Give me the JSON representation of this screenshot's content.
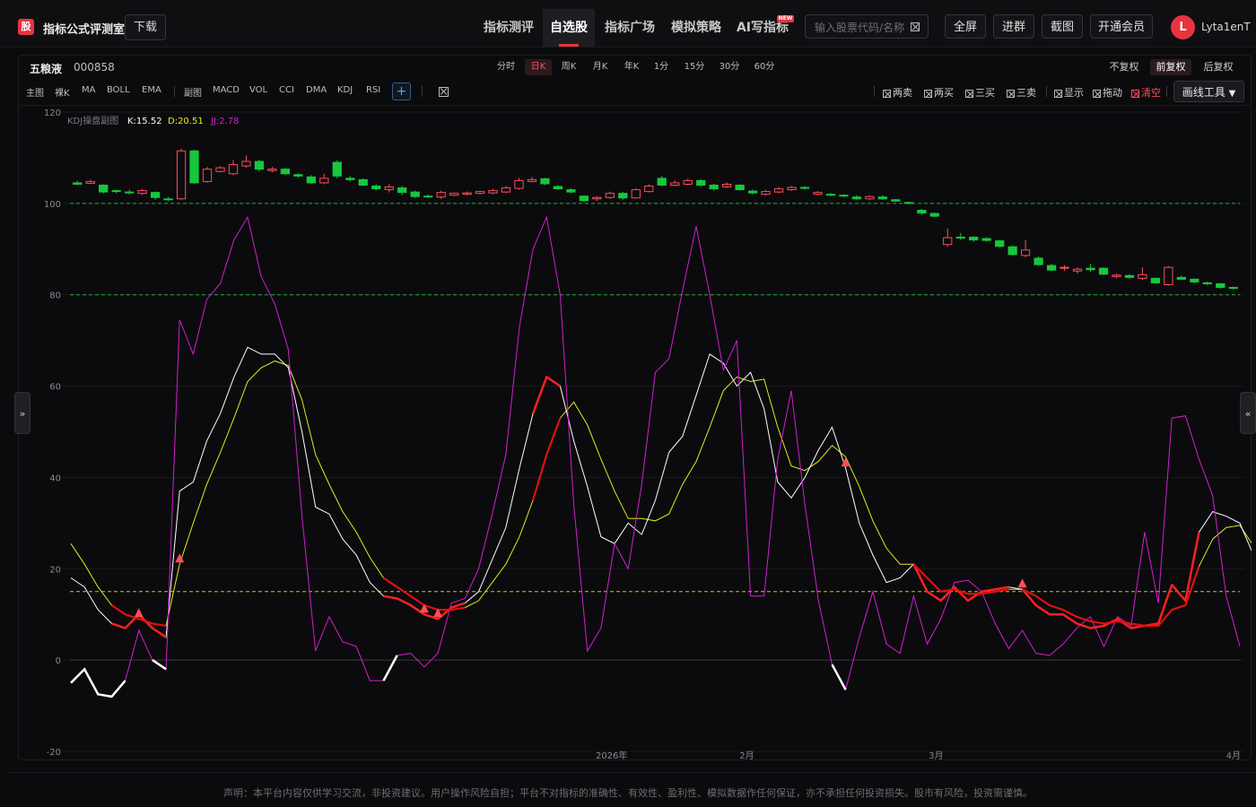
{
  "header": {
    "logo_text": "股",
    "app_title": "指标公式评测室",
    "download_label": "下载",
    "nav": [
      {
        "label": "指标测评",
        "active": false
      },
      {
        "label": "自选股",
        "active": true
      },
      {
        "label": "指标广场",
        "active": false
      },
      {
        "label": "模拟策略",
        "active": false
      },
      {
        "label": "AI写指标",
        "active": false
      }
    ],
    "new_badge": "NEW",
    "search_placeholder": "输入股票代码/名称",
    "buttons": {
      "fullscreen": "全屏",
      "join_group": "进群",
      "screenshot": "截图",
      "membership": "开通会员"
    },
    "avatar_letter": "L",
    "username": "Lyta1enT"
  },
  "stock": {
    "name": "五粮液",
    "code": "000858"
  },
  "periods": [
    {
      "label": "分时",
      "active": false
    },
    {
      "label": "日K",
      "active": true
    },
    {
      "label": "周K",
      "active": false
    },
    {
      "label": "月K",
      "active": false
    },
    {
      "label": "年K",
      "active": false
    },
    {
      "label": "1分",
      "active": false
    },
    {
      "label": "15分",
      "active": false
    },
    {
      "label": "30分",
      "active": false
    },
    {
      "label": "60分",
      "active": false
    }
  ],
  "adjust": [
    {
      "label": "不复权",
      "active": false
    },
    {
      "label": "前复权",
      "active": true
    },
    {
      "label": "后复权",
      "active": false
    }
  ],
  "main_indicators": [
    "主图",
    "裸K",
    "MA",
    "BOLL",
    "EMA"
  ],
  "sub_indicators": [
    "副图",
    "MACD",
    "VOL",
    "CCI",
    "DMA",
    "KDJ",
    "RSI"
  ],
  "signal_tools": [
    {
      "label": "两卖",
      "red": false
    },
    {
      "label": "两买",
      "red": false
    },
    {
      "label": "三买",
      "red": false
    },
    {
      "label": "三卖",
      "red": false
    },
    {
      "label": "显示",
      "red": false
    },
    {
      "label": "拖动",
      "red": false
    },
    {
      "label": "清空",
      "red": true
    }
  ],
  "draw_tools_label": "画线工具",
  "sidebar_toggle_left": "»",
  "sidebar_toggle_right": "«",
  "disclaimer": "声明：本平台内容仅供学习交流，非投资建议。用户操作风险自担；平台不对指标的准确性、有效性、盈利性、模拟数据作任何保证，亦不承担任何投资损失。股市有风险，投资需谨慎。",
  "chart_data": {
    "type": "line",
    "indicator_label": "KDJ操盘副图",
    "legend": [
      {
        "label": "K:15.52",
        "color": "#ffffff"
      },
      {
        "label": "D:20.51",
        "color": "#e8e820"
      },
      {
        "label": "JJ:2.78",
        "color": "#d020d0"
      }
    ],
    "ylim": [
      -20,
      120
    ],
    "y_ticks": [
      -20,
      0,
      20,
      40,
      60,
      80,
      100,
      120
    ],
    "x_labels": [
      {
        "index": 20,
        "label": "2026年"
      },
      {
        "index": 25,
        "label": "2月"
      },
      {
        "index": 32,
        "label": "3月"
      },
      {
        "index": 43,
        "label": "4月"
      }
    ],
    "levels": [
      {
        "value": 100,
        "color": "#1fae3a"
      },
      {
        "value": 80,
        "color": "#1fae3a"
      },
      {
        "value": 15,
        "color": "#c8c820"
      },
      {
        "value": 0,
        "color": "#3a3a3e"
      }
    ],
    "k": [
      18,
      16,
      11,
      8,
      7,
      10,
      7,
      5,
      37,
      39,
      48,
      54,
      62,
      68.5,
      67,
      67,
      64,
      50,
      33.5,
      32,
      26.5,
      23,
      17,
      14,
      13.5,
      12,
      10,
      9,
      11.5,
      12.5,
      15,
      22,
      29,
      42,
      54,
      62,
      60,
      48,
      38,
      27,
      25.5,
      30,
      27.5,
      35,
      45.5,
      49,
      58,
      67,
      65,
      60,
      63,
      55,
      39,
      35.5,
      40,
      46,
      51,
      42,
      30,
      23,
      17,
      18,
      21,
      15,
      13,
      16,
      13,
      15,
      15.5,
      16,
      15.5,
      12,
      10,
      10,
      8,
      7,
      7.5,
      9,
      7,
      7.5,
      8,
      16.5,
      13,
      28,
      32.5,
      31.5,
      30,
      23,
      15.5
    ],
    "d": [
      25.5,
      21,
      16,
      12,
      10,
      9,
      8,
      7.5,
      21,
      30,
      38.5,
      45.5,
      53,
      61,
      64,
      65.5,
      64.5,
      57,
      45,
      38.5,
      32.5,
      28,
      22.5,
      18,
      16,
      14,
      12,
      11,
      11,
      11.5,
      13,
      17,
      21,
      27,
      35,
      45,
      53,
      56.5,
      51.5,
      44,
      37,
      31,
      31,
      30.5,
      32,
      38.5,
      43.5,
      51,
      59,
      62,
      61,
      61.5,
      51,
      42.5,
      41.5,
      43.5,
      47,
      44.5,
      38,
      30.5,
      24.5,
      21,
      21,
      18,
      15,
      15.5,
      14.5,
      14.5,
      15,
      15.5,
      15.5,
      14,
      12,
      11,
      9.5,
      8.5,
      8,
      8.5,
      8,
      7.5,
      7.5,
      11,
      12,
      20.5,
      26.5,
      29,
      29.5,
      25,
      20.5
    ],
    "j": [
      -5,
      -2,
      -7.5,
      -8,
      -4.5,
      6.5,
      0,
      -2,
      74.5,
      67,
      79,
      82.5,
      92,
      97,
      84,
      78,
      68,
      31.5,
      2,
      9.5,
      4,
      3,
      -4.5,
      -4.5,
      1,
      1.5,
      -1.5,
      1.5,
      12.5,
      13.5,
      20,
      32,
      45,
      73,
      90,
      97,
      80,
      34,
      2,
      7,
      25.5,
      20,
      38.5,
      63,
      66,
      81,
      95,
      80,
      63.5,
      70,
      14,
      14,
      44,
      59,
      34,
      13,
      -1,
      -6.5,
      5,
      15,
      3.5,
      1.5,
      14,
      3.5,
      9,
      17,
      17.5,
      15,
      8,
      2.5,
      6.5,
      1.5,
      1,
      3.5,
      7,
      9.5,
      3,
      9.5,
      7.5,
      28,
      12.5,
      53,
      53.5,
      44,
      36,
      14,
      3
    ],
    "k_white_segments": [
      [
        0,
        4
      ],
      [
        6,
        7
      ],
      [
        23,
        24
      ],
      [
        56,
        57
      ]
    ],
    "red_thick_segments": [
      [
        3,
        7
      ],
      [
        23,
        29
      ],
      [
        34,
        36
      ],
      [
        62,
        69
      ],
      [
        70,
        81
      ],
      [
        81,
        83
      ]
    ],
    "buy_markers": [
      5,
      8,
      26,
      27,
      57,
      70
    ],
    "candles": [
      [
        104.5,
        104.2,
        105,
        104
      ],
      [
        104.4,
        104.8,
        105.2,
        104.2
      ],
      [
        104,
        102.5,
        104.2,
        102.2
      ],
      [
        102.8,
        102.6,
        103,
        102.2
      ],
      [
        102.5,
        102.3,
        103,
        102
      ],
      [
        102.2,
        102.8,
        103.2,
        101.8
      ],
      [
        102.4,
        101.3,
        102.6,
        100.8
      ],
      [
        101,
        100.8,
        101.4,
        100.5
      ],
      [
        101,
        111.5,
        112,
        100.8
      ],
      [
        111.5,
        104.5,
        111.8,
        104.3
      ],
      [
        104.8,
        107.5,
        108,
        104.5
      ],
      [
        107,
        107.8,
        108.2,
        106.8
      ],
      [
        106.5,
        108.5,
        109.5,
        106.2
      ],
      [
        108.2,
        109.2,
        110.5,
        107.8
      ],
      [
        109.2,
        107.5,
        109.6,
        107
      ],
      [
        107.2,
        107.5,
        108,
        106.8
      ],
      [
        107.5,
        106.5,
        107.8,
        106.2
      ],
      [
        106.3,
        106,
        106.6,
        105.6
      ],
      [
        105.8,
        104.5,
        106.2,
        104.2
      ],
      [
        104.5,
        105.5,
        106.5,
        104.2
      ],
      [
        109,
        106,
        109.5,
        105.5
      ],
      [
        105.5,
        105.2,
        106,
        104.8
      ],
      [
        105.2,
        104,
        105.5,
        103.8
      ],
      [
        103.8,
        103.2,
        104.2,
        102.8
      ],
      [
        103,
        103.6,
        104.2,
        102.4
      ],
      [
        103.4,
        102.4,
        103.8,
        101.8
      ],
      [
        102.5,
        101.5,
        102.8,
        101.2
      ],
      [
        101.6,
        101.5,
        102,
        101.2
      ],
      [
        101.4,
        102.4,
        102.8,
        101
      ],
      [
        101.8,
        102.2,
        102.4,
        101.6
      ],
      [
        102,
        102.3,
        102.6,
        101.7
      ],
      [
        102.2,
        102.6,
        102.8,
        101.9
      ],
      [
        102.3,
        102.8,
        103.2,
        102
      ],
      [
        102.5,
        103.4,
        103.8,
        102.2
      ],
      [
        103.3,
        105,
        105.6,
        103
      ],
      [
        104.8,
        105.2,
        105.8,
        104.6
      ],
      [
        105.4,
        104.3,
        105.6,
        104
      ],
      [
        103.7,
        103.2,
        104,
        103
      ],
      [
        103,
        102.5,
        103.3,
        102.2
      ],
      [
        101.6,
        100.6,
        101.8,
        100.3
      ],
      [
        101,
        101.3,
        101.6,
        100.5
      ],
      [
        101.3,
        102.2,
        102.6,
        101
      ],
      [
        102.2,
        101.2,
        102.5,
        100.8
      ],
      [
        101.2,
        103,
        103.3,
        101
      ],
      [
        102.6,
        103.8,
        104.2,
        102.4
      ],
      [
        105.5,
        104,
        106,
        103.8
      ],
      [
        104,
        104.5,
        105,
        103.8
      ],
      [
        104.2,
        105,
        105.4,
        104
      ],
      [
        105,
        104,
        105.3,
        103.6
      ],
      [
        104,
        103.2,
        104.3,
        102.8
      ],
      [
        103.6,
        104.2,
        104.6,
        103.4
      ],
      [
        104,
        103,
        104.2,
        102.8
      ],
      [
        102.7,
        102.3,
        103,
        102
      ],
      [
        102,
        102.6,
        103,
        101.7
      ],
      [
        102.5,
        103.2,
        103.6,
        102.2
      ],
      [
        103,
        103.5,
        103.8,
        102.7
      ],
      [
        103.5,
        103.3,
        103.8,
        103
      ],
      [
        102,
        102.4,
        102.7,
        101.8
      ],
      [
        102,
        101.8,
        102.3,
        101.5
      ],
      [
        101.8,
        101.6,
        102,
        101.3
      ],
      [
        101.4,
        101,
        101.8,
        100.8
      ],
      [
        101,
        101.5,
        101.8,
        100.7
      ],
      [
        101.4,
        101,
        101.8,
        100.8
      ],
      [
        100.8,
        100.5,
        101,
        100.3
      ],
      [
        100.2,
        100,
        100.4,
        99.8
      ],
      [
        98.5,
        97.9,
        98.8,
        97.5
      ],
      [
        97.8,
        97.2,
        98,
        97
      ],
      [
        91,
        92.5,
        94.5,
        90.5
      ],
      [
        92.6,
        92.5,
        93.5,
        92
      ],
      [
        92.6,
        92,
        92.8,
        91.6
      ],
      [
        92.3,
        91.9,
        92.6,
        91.6
      ],
      [
        91.8,
        90.6,
        92,
        90.3
      ],
      [
        90.5,
        88.8,
        90.8,
        88.6
      ],
      [
        88.6,
        89.8,
        92,
        88.2
      ],
      [
        88,
        86.6,
        88.4,
        86.3
      ],
      [
        86.4,
        85.4,
        86.8,
        85.2
      ],
      [
        85.8,
        86,
        86.5,
        85.2
      ],
      [
        85.2,
        85.6,
        86,
        84.6
      ],
      [
        85.8,
        85.5,
        86.8,
        85
      ],
      [
        85.8,
        84.5,
        86,
        84.3
      ],
      [
        84,
        84.3,
        84.6,
        83.6
      ],
      [
        84.2,
        83.8,
        84.5,
        83.5
      ],
      [
        83.6,
        84.4,
        86,
        83.2
      ],
      [
        83.6,
        82.6,
        83.8,
        82.4
      ],
      [
        82.2,
        86,
        86.3,
        82
      ],
      [
        83.8,
        83.4,
        84.2,
        83.2
      ],
      [
        83.4,
        82.8,
        83.6,
        82.5
      ],
      [
        82.6,
        82.4,
        82.9,
        82.1
      ],
      [
        82.4,
        81.6,
        82.6,
        81.3
      ],
      [
        81.6,
        81.4,
        81.8,
        81.1
      ]
    ]
  }
}
